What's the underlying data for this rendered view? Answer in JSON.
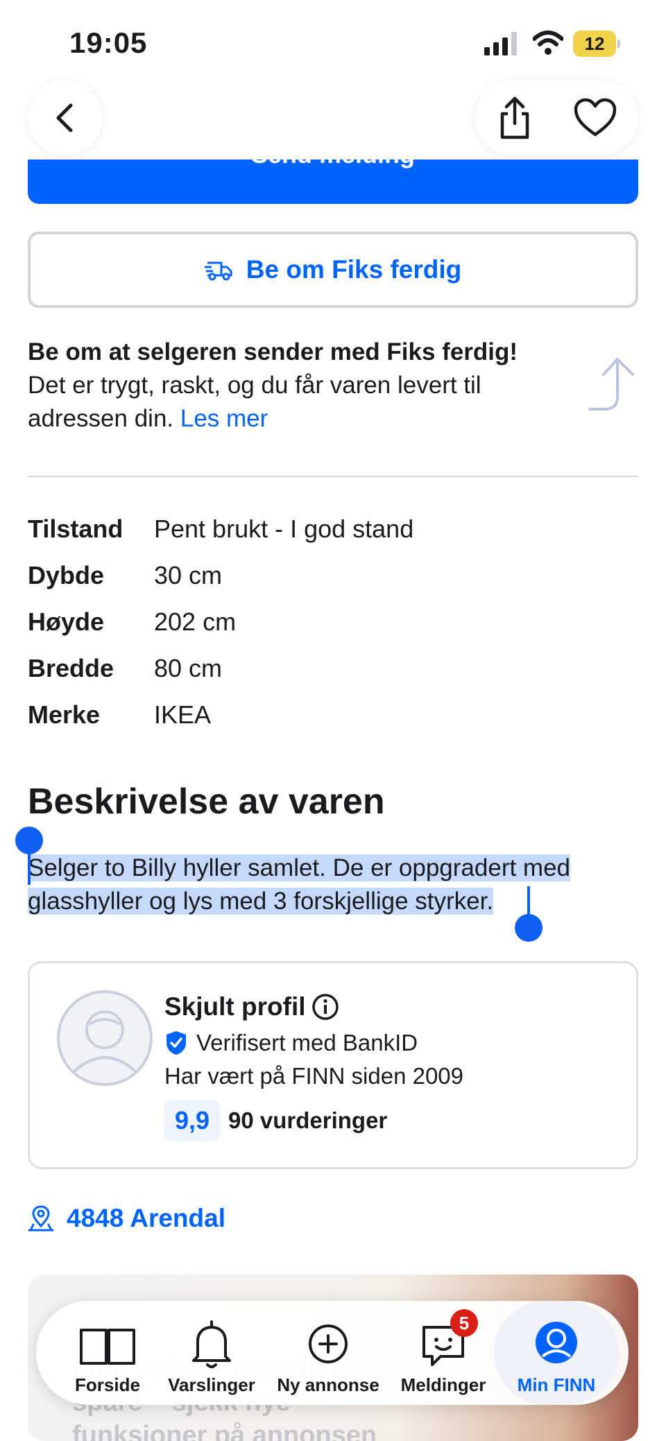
{
  "status_bar": {
    "time": "19:05",
    "battery": "12"
  },
  "nav": {
    "back_icon": "chevron-left-icon",
    "share_icon": "share-icon",
    "favorite_icon": "heart-icon"
  },
  "send_button": {
    "label": "Send melding"
  },
  "fiks_button": {
    "label": "Be om Fiks ferdig",
    "icon": "delivery-truck-icon"
  },
  "promo": {
    "title": "Be om at selgeren sender med Fiks ferdig!",
    "text": "Det er trygt, raskt, og du får varen levert til adressen din.",
    "link": "Les mer"
  },
  "specs": [
    {
      "key": "Tilstand",
      "value": "Pent brukt - I god stand"
    },
    {
      "key": "Dybde",
      "value": "30 cm"
    },
    {
      "key": "Høyde",
      "value": "202 cm"
    },
    {
      "key": "Bredde",
      "value": "80 cm"
    },
    {
      "key": "Merke",
      "value": "IKEA"
    }
  ],
  "description": {
    "title": "Beskrivelse av varen",
    "text": "Selger to Billy hyller samlet. De er oppgradert med glasshyller og lys med 3 forskjellige styrker."
  },
  "seller": {
    "name": "Skjult profil",
    "verified": "Verifisert med BankID",
    "since": "Har vært på FINN siden 2009",
    "rating": "9,9",
    "reviews": "90 vurderinger"
  },
  "location": {
    "text": "4848 Arendal"
  },
  "promo_card": {
    "text": "Finn ut hvor mye du kan spare – sjekk nye funksjoner på annonsen"
  },
  "tabs": [
    {
      "label": "Forside",
      "icon": "book-icon"
    },
    {
      "label": "Varslinger",
      "icon": "bell-icon"
    },
    {
      "label": "Ny annonse",
      "icon": "plus-circle-icon"
    },
    {
      "label": "Meldinger",
      "icon": "chat-icon",
      "badge": "5"
    },
    {
      "label": "Min FINN",
      "icon": "profile-icon"
    }
  ],
  "colors": {
    "accent": "#0063fb",
    "badge": "#d91f16",
    "selection": "#c5d9fb"
  }
}
